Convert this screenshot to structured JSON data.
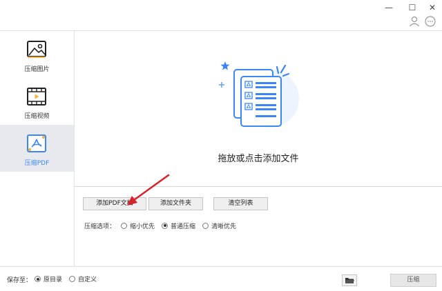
{
  "window": {
    "minimize_label": "—",
    "maximize_label": "☐",
    "close_label": "✕",
    "icons": [
      "user-icon",
      "feedback-icon"
    ]
  },
  "sidebar": {
    "items": [
      {
        "label": "压缩图片",
        "icon": "image-icon",
        "active": false
      },
      {
        "label": "压缩视频",
        "icon": "video-icon",
        "active": false
      },
      {
        "label": "压缩PDF",
        "icon": "pdf-icon",
        "active": true
      }
    ],
    "accent_color": "#3a86f5"
  },
  "dropzone": {
    "text": "拖放或点击添加文件",
    "icon": "pdf-documents-illustration"
  },
  "actions": {
    "add_pdf": "添加PDF文档",
    "add_folder": "添加文件夹",
    "clear_list": "清空列表"
  },
  "compress_options": {
    "label": "压缩选项：",
    "options": [
      {
        "label": "缩小优先",
        "checked": false
      },
      {
        "label": "普通压缩",
        "checked": true
      },
      {
        "label": "清晰优先",
        "checked": false
      }
    ]
  },
  "bottom": {
    "save_to_label": "保存至：",
    "save_options": [
      {
        "label": "原目录",
        "checked": true
      },
      {
        "label": "自定义",
        "checked": false
      }
    ],
    "folder_icon": "folder-open-icon",
    "compress_label": "压缩"
  },
  "annotation": {
    "arrow_color": "#d9232a"
  }
}
